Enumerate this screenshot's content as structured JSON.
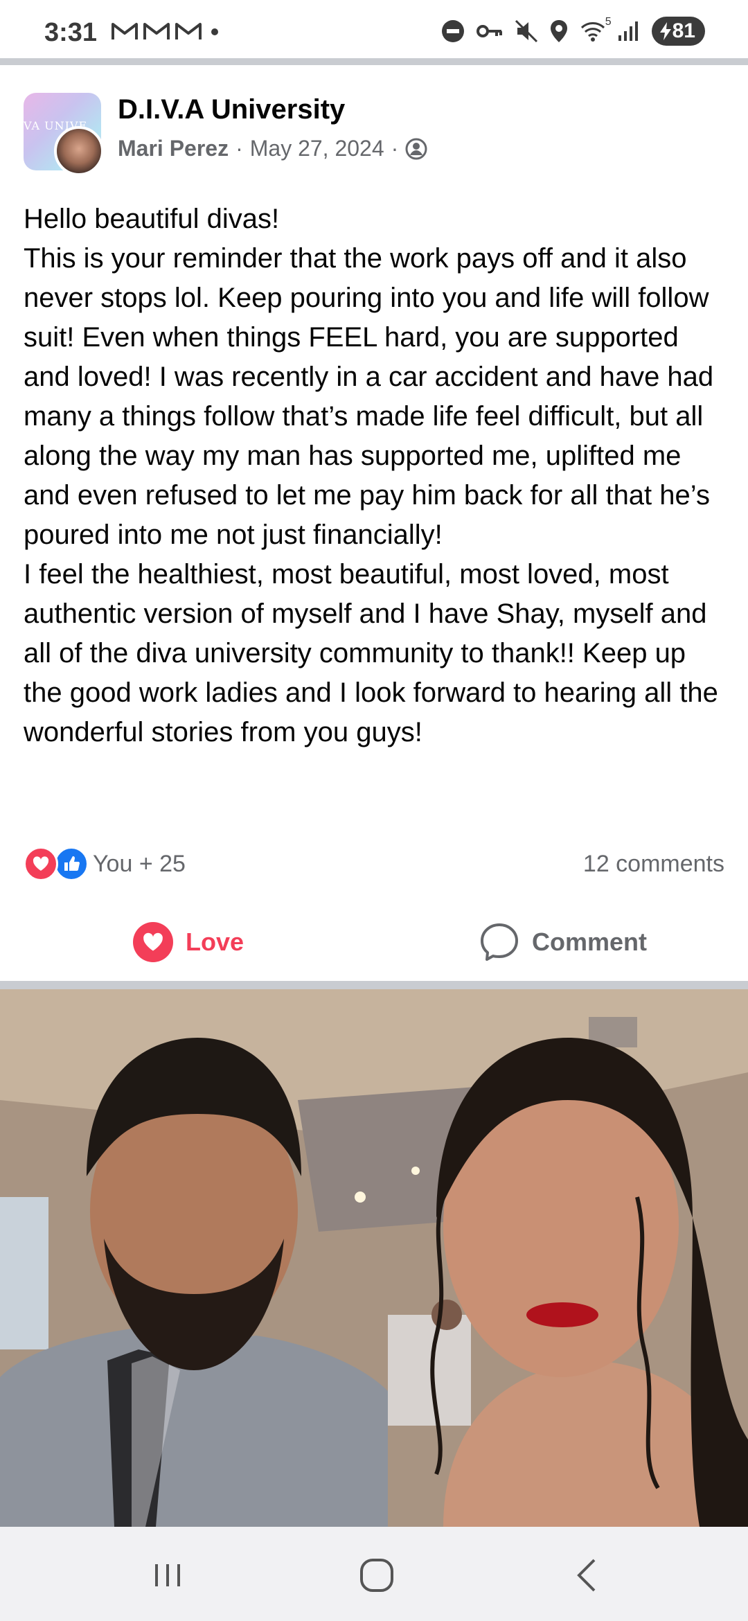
{
  "status_bar": {
    "time": "3:31",
    "notification_icons": [
      "gmail-icon",
      "gmail-icon",
      "gmail-icon",
      "dot-icon"
    ],
    "system_icons": [
      "do-not-disturb-icon",
      "vpn-key-icon",
      "mute-icon",
      "location-icon",
      "wifi-icon",
      "signal-icon"
    ],
    "wifi_label": "5",
    "battery": "81"
  },
  "post": {
    "group_name": "D.I.V.A University",
    "group_avatar_text": "VA UNIVE",
    "author": "Mari Perez",
    "date": "May 27, 2024",
    "separator": "·",
    "privacy_icon": "group-privacy-icon",
    "paragraphs": [
      "Hello beautiful divas!",
      "This is your reminder that the work pays off and it also never stops lol. Keep pouring into you and life will follow suit! Even when things FEEL hard, you are supported and loved! I was recently in a car accident and have had many a things follow that’s made life feel difficult, but all along the way my man has supported me, uplifted me and even refused to let me pay him back for all that he’s poured into me not just financially!",
      "I feel the healthiest, most beautiful, most loved, most authentic version of myself and I have Shay, myself and all of the diva university community to thank!! Keep up the good work ladies and I look forward to hearing all the wonderful stories from you guys!"
    ],
    "reaction_summary": "You + 25",
    "comments_count": "12 comments",
    "love_label": "Love",
    "comment_label": "Comment"
  },
  "colors": {
    "love": "#f33e58",
    "like": "#1877f2",
    "secondary_text": "#65676b"
  },
  "nav": {
    "recents_icon": "recents-icon",
    "home_icon": "home-icon",
    "back_icon": "back-icon"
  }
}
